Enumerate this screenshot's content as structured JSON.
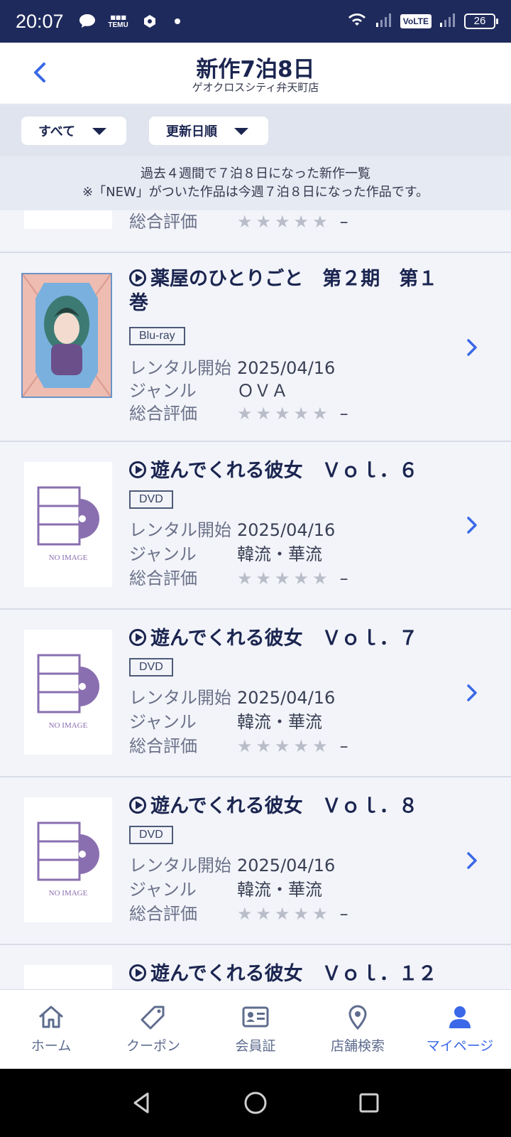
{
  "status_bar": {
    "time": "20:07",
    "temu_label": "TEMU",
    "volte": "VoLTE",
    "battery": "26"
  },
  "header": {
    "title": "新作7泊8日",
    "subtitle": "ゲオクロスシティ弁天町店"
  },
  "filters": {
    "category": "すべて",
    "sort": "更新日順"
  },
  "notice": {
    "line1": "過去４週間で７泊８日になった新作一覧",
    "line2": "※「NEW」がついた作品は今週７泊８日になった作品です。"
  },
  "labels": {
    "rental_start": "レンタル開始",
    "genre": "ジャンル",
    "rating": "総合評価",
    "stars": "★★★★★",
    "dash": "–",
    "no_image": "NO IMAGE"
  },
  "items": [
    {
      "title": "",
      "format": "",
      "rental_start": "",
      "genre": ""
    },
    {
      "title": "薬屋のひとりごと　第２期　第１巻",
      "format": "Blu-ray",
      "rental_start": "2025/04/16",
      "genre": "ＯＶＡ"
    },
    {
      "title": "遊んでくれる彼女　Ｖｏｌ．６",
      "format": "DVD",
      "rental_start": "2025/04/16",
      "genre": "韓流・華流"
    },
    {
      "title": "遊んでくれる彼女　Ｖｏｌ．７",
      "format": "DVD",
      "rental_start": "2025/04/16",
      "genre": "韓流・華流"
    },
    {
      "title": "遊んでくれる彼女　Ｖｏｌ．８",
      "format": "DVD",
      "rental_start": "2025/04/16",
      "genre": "韓流・華流"
    },
    {
      "title": "遊んでくれる彼女　Ｖｏｌ．１２",
      "format": "",
      "rental_start": "",
      "genre": ""
    }
  ],
  "tabs": [
    {
      "label": "ホーム",
      "icon": "home-icon"
    },
    {
      "label": "クーポン",
      "icon": "coupon-icon"
    },
    {
      "label": "会員証",
      "icon": "member-card-icon"
    },
    {
      "label": "店舗検索",
      "icon": "location-pin-icon"
    },
    {
      "label": "マイページ",
      "icon": "person-icon",
      "active": true
    }
  ],
  "colors": {
    "navy": "#1f2a5c",
    "accent": "#3a68e8",
    "star": "#b9bdc9"
  }
}
